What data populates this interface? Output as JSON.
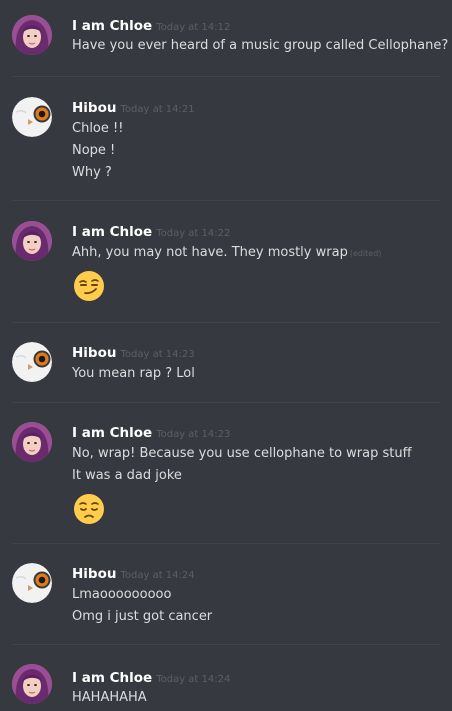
{
  "messages": [
    {
      "author": "I am Chloe",
      "avatar": "chloe-avatar",
      "timestamp": "Today at 14:12",
      "lines": [
        "Have you ever heard of a music group called Cellophane?"
      ]
    },
    {
      "author": "Hibou",
      "avatar": "owl-avatar",
      "timestamp": "Today at 14:21",
      "lines": [
        "Chloe !!",
        "Nope !",
        "Why ?"
      ]
    },
    {
      "author": "I am Chloe",
      "avatar": "chloe-avatar",
      "timestamp": "Today at 14:22",
      "lines": [
        "Ahh, you may not have. They mostly wrap"
      ],
      "edited_label": "(edited)",
      "emoji": "smirking-face-emoji"
    },
    {
      "author": "Hibou",
      "avatar": "owl-avatar",
      "timestamp": "Today at 14:23",
      "lines": [
        "You mean rap ? Lol"
      ]
    },
    {
      "author": "I am Chloe",
      "avatar": "chloe-avatar",
      "timestamp": "Today at 14:23",
      "lines": [
        "No, wrap! Because you use cellophane to wrap stuff",
        "It was a dad joke"
      ],
      "emoji": "pensive-face-emoji"
    },
    {
      "author": "Hibou",
      "avatar": "owl-avatar",
      "timestamp": "Today at 14:24",
      "lines": [
        "Lmaooooooooo",
        "Omg i just got cancer"
      ]
    },
    {
      "author": "I am Chloe",
      "avatar": "chloe-avatar",
      "timestamp": "Today at 14:24",
      "lines": [
        "HAHAHAHA"
      ]
    }
  ],
  "colors": {
    "background": "#36393f",
    "author": "#ffffff",
    "timestamp": "#5c5f65",
    "text": "#dcddde",
    "divider": "#40444b",
    "emoji_yellow": "#ffcc4d"
  }
}
